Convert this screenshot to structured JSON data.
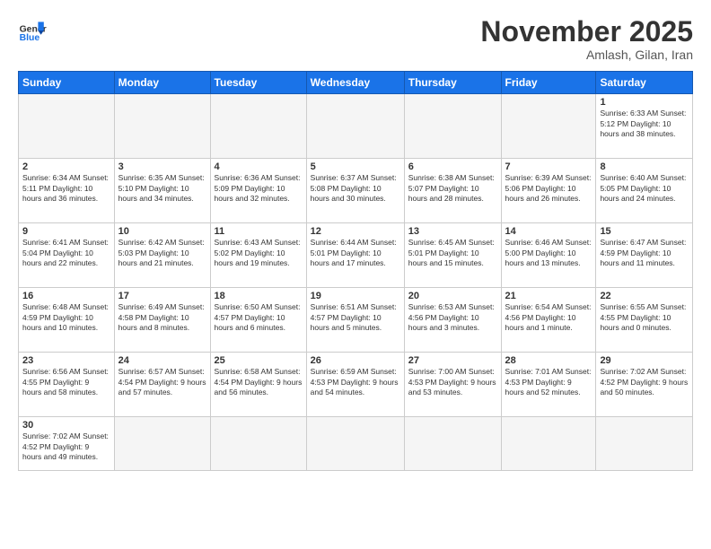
{
  "header": {
    "logo_general": "General",
    "logo_blue": "Blue",
    "month_title": "November 2025",
    "location": "Amlash, Gilan, Iran"
  },
  "weekdays": [
    "Sunday",
    "Monday",
    "Tuesday",
    "Wednesday",
    "Thursday",
    "Friday",
    "Saturday"
  ],
  "weeks": [
    [
      {
        "day": "",
        "info": ""
      },
      {
        "day": "",
        "info": ""
      },
      {
        "day": "",
        "info": ""
      },
      {
        "day": "",
        "info": ""
      },
      {
        "day": "",
        "info": ""
      },
      {
        "day": "",
        "info": ""
      },
      {
        "day": "1",
        "info": "Sunrise: 6:33 AM\nSunset: 5:12 PM\nDaylight: 10 hours\nand 38 minutes."
      }
    ],
    [
      {
        "day": "2",
        "info": "Sunrise: 6:34 AM\nSunset: 5:11 PM\nDaylight: 10 hours\nand 36 minutes."
      },
      {
        "day": "3",
        "info": "Sunrise: 6:35 AM\nSunset: 5:10 PM\nDaylight: 10 hours\nand 34 minutes."
      },
      {
        "day": "4",
        "info": "Sunrise: 6:36 AM\nSunset: 5:09 PM\nDaylight: 10 hours\nand 32 minutes."
      },
      {
        "day": "5",
        "info": "Sunrise: 6:37 AM\nSunset: 5:08 PM\nDaylight: 10 hours\nand 30 minutes."
      },
      {
        "day": "6",
        "info": "Sunrise: 6:38 AM\nSunset: 5:07 PM\nDaylight: 10 hours\nand 28 minutes."
      },
      {
        "day": "7",
        "info": "Sunrise: 6:39 AM\nSunset: 5:06 PM\nDaylight: 10 hours\nand 26 minutes."
      },
      {
        "day": "8",
        "info": "Sunrise: 6:40 AM\nSunset: 5:05 PM\nDaylight: 10 hours\nand 24 minutes."
      }
    ],
    [
      {
        "day": "9",
        "info": "Sunrise: 6:41 AM\nSunset: 5:04 PM\nDaylight: 10 hours\nand 22 minutes."
      },
      {
        "day": "10",
        "info": "Sunrise: 6:42 AM\nSunset: 5:03 PM\nDaylight: 10 hours\nand 21 minutes."
      },
      {
        "day": "11",
        "info": "Sunrise: 6:43 AM\nSunset: 5:02 PM\nDaylight: 10 hours\nand 19 minutes."
      },
      {
        "day": "12",
        "info": "Sunrise: 6:44 AM\nSunset: 5:01 PM\nDaylight: 10 hours\nand 17 minutes."
      },
      {
        "day": "13",
        "info": "Sunrise: 6:45 AM\nSunset: 5:01 PM\nDaylight: 10 hours\nand 15 minutes."
      },
      {
        "day": "14",
        "info": "Sunrise: 6:46 AM\nSunset: 5:00 PM\nDaylight: 10 hours\nand 13 minutes."
      },
      {
        "day": "15",
        "info": "Sunrise: 6:47 AM\nSunset: 4:59 PM\nDaylight: 10 hours\nand 11 minutes."
      }
    ],
    [
      {
        "day": "16",
        "info": "Sunrise: 6:48 AM\nSunset: 4:59 PM\nDaylight: 10 hours\nand 10 minutes."
      },
      {
        "day": "17",
        "info": "Sunrise: 6:49 AM\nSunset: 4:58 PM\nDaylight: 10 hours\nand 8 minutes."
      },
      {
        "day": "18",
        "info": "Sunrise: 6:50 AM\nSunset: 4:57 PM\nDaylight: 10 hours\nand 6 minutes."
      },
      {
        "day": "19",
        "info": "Sunrise: 6:51 AM\nSunset: 4:57 PM\nDaylight: 10 hours\nand 5 minutes."
      },
      {
        "day": "20",
        "info": "Sunrise: 6:53 AM\nSunset: 4:56 PM\nDaylight: 10 hours\nand 3 minutes."
      },
      {
        "day": "21",
        "info": "Sunrise: 6:54 AM\nSunset: 4:56 PM\nDaylight: 10 hours\nand 1 minute."
      },
      {
        "day": "22",
        "info": "Sunrise: 6:55 AM\nSunset: 4:55 PM\nDaylight: 10 hours\nand 0 minutes."
      }
    ],
    [
      {
        "day": "23",
        "info": "Sunrise: 6:56 AM\nSunset: 4:55 PM\nDaylight: 9 hours\nand 58 minutes."
      },
      {
        "day": "24",
        "info": "Sunrise: 6:57 AM\nSunset: 4:54 PM\nDaylight: 9 hours\nand 57 minutes."
      },
      {
        "day": "25",
        "info": "Sunrise: 6:58 AM\nSunset: 4:54 PM\nDaylight: 9 hours\nand 56 minutes."
      },
      {
        "day": "26",
        "info": "Sunrise: 6:59 AM\nSunset: 4:53 PM\nDaylight: 9 hours\nand 54 minutes."
      },
      {
        "day": "27",
        "info": "Sunrise: 7:00 AM\nSunset: 4:53 PM\nDaylight: 9 hours\nand 53 minutes."
      },
      {
        "day": "28",
        "info": "Sunrise: 7:01 AM\nSunset: 4:53 PM\nDaylight: 9 hours\nand 52 minutes."
      },
      {
        "day": "29",
        "info": "Sunrise: 7:02 AM\nSunset: 4:52 PM\nDaylight: 9 hours\nand 50 minutes."
      }
    ],
    [
      {
        "day": "30",
        "info": "Sunrise: 7:02 AM\nSunset: 4:52 PM\nDaylight: 9 hours\nand 49 minutes."
      },
      {
        "day": "",
        "info": ""
      },
      {
        "day": "",
        "info": ""
      },
      {
        "day": "",
        "info": ""
      },
      {
        "day": "",
        "info": ""
      },
      {
        "day": "",
        "info": ""
      },
      {
        "day": "",
        "info": ""
      }
    ]
  ]
}
